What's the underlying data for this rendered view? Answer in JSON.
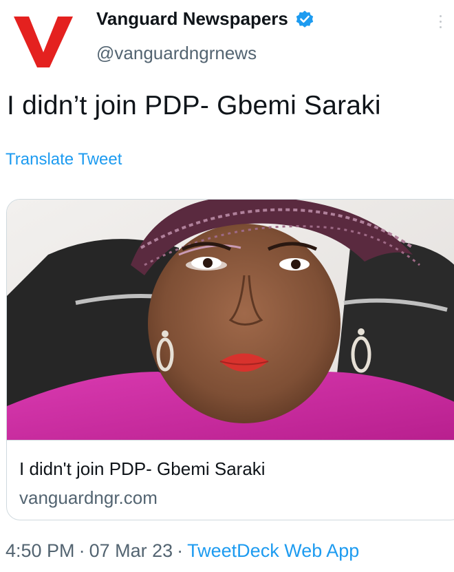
{
  "author": {
    "name": "Vanguard Newspapers",
    "handle": "@vanguardngrnews",
    "avatar_icon": "vanguard-v-logo",
    "verified_icon": "verified-badge-icon"
  },
  "tweet": {
    "text": "I didn’t join PDP- Gbemi Saraki",
    "translate_label": "Translate Tweet"
  },
  "card": {
    "image_icon": "article-photo",
    "title": "I didn't join PDP- Gbemi Saraki",
    "domain": "vanguardngr.com"
  },
  "meta": {
    "time": "4:50 PM",
    "date": "07 Mar 23",
    "source": "TweetDeck Web App",
    "separator": "·"
  },
  "colors": {
    "accent": "#1d9bf0",
    "brand_red": "#e4211f",
    "text": "#0f1419",
    "secondary": "#536471"
  }
}
